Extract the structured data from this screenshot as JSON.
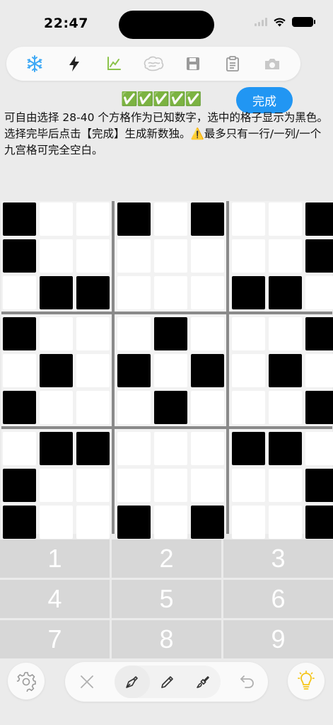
{
  "status_bar": {
    "time": "22:47"
  },
  "toolbar": {
    "icons": [
      "snowflake-icon",
      "bolt-icon",
      "chart-icon",
      "brain-icon",
      "save-icon",
      "clipboard-icon",
      "camera-icon"
    ]
  },
  "selection": {
    "checks": "✅✅✅✅✅",
    "done_label": "完成",
    "instructions": "可自由选择 28-40 个方格作为已知数字，选中的格子显示为黑色。选择完毕后点击【完成】生成新数独。⚠️最多只有一行/一列/一个九宫格可完全空白。"
  },
  "grid": {
    "rows": [
      [
        1,
        0,
        0,
        1,
        0,
        1,
        0,
        0,
        1
      ],
      [
        1,
        0,
        0,
        0,
        0,
        0,
        0,
        0,
        1
      ],
      [
        0,
        1,
        1,
        0,
        0,
        0,
        1,
        1,
        0
      ],
      [
        1,
        0,
        0,
        0,
        1,
        0,
        0,
        0,
        1
      ],
      [
        0,
        1,
        0,
        1,
        0,
        1,
        0,
        1,
        0
      ],
      [
        1,
        0,
        0,
        0,
        1,
        0,
        0,
        0,
        1
      ],
      [
        0,
        1,
        1,
        0,
        0,
        0,
        1,
        1,
        0
      ],
      [
        1,
        0,
        0,
        0,
        0,
        0,
        0,
        0,
        1
      ],
      [
        1,
        0,
        0,
        1,
        0,
        1,
        0,
        0,
        1
      ]
    ]
  },
  "keypad": {
    "keys": [
      "1",
      "2",
      "3",
      "4",
      "5",
      "6",
      "7",
      "8",
      "9"
    ]
  },
  "bottom_bar": {
    "left": "settings-icon",
    "modes": [
      "close-icon",
      "fountain-pen-icon",
      "pencil-icon",
      "brush-icon",
      "undo-icon"
    ],
    "right": "lightbulb-icon",
    "accent": "#f5c518"
  },
  "colors": {
    "accent": "#2196f3",
    "selected_cell": "#000000",
    "key_bg": "#d7d7d7"
  }
}
